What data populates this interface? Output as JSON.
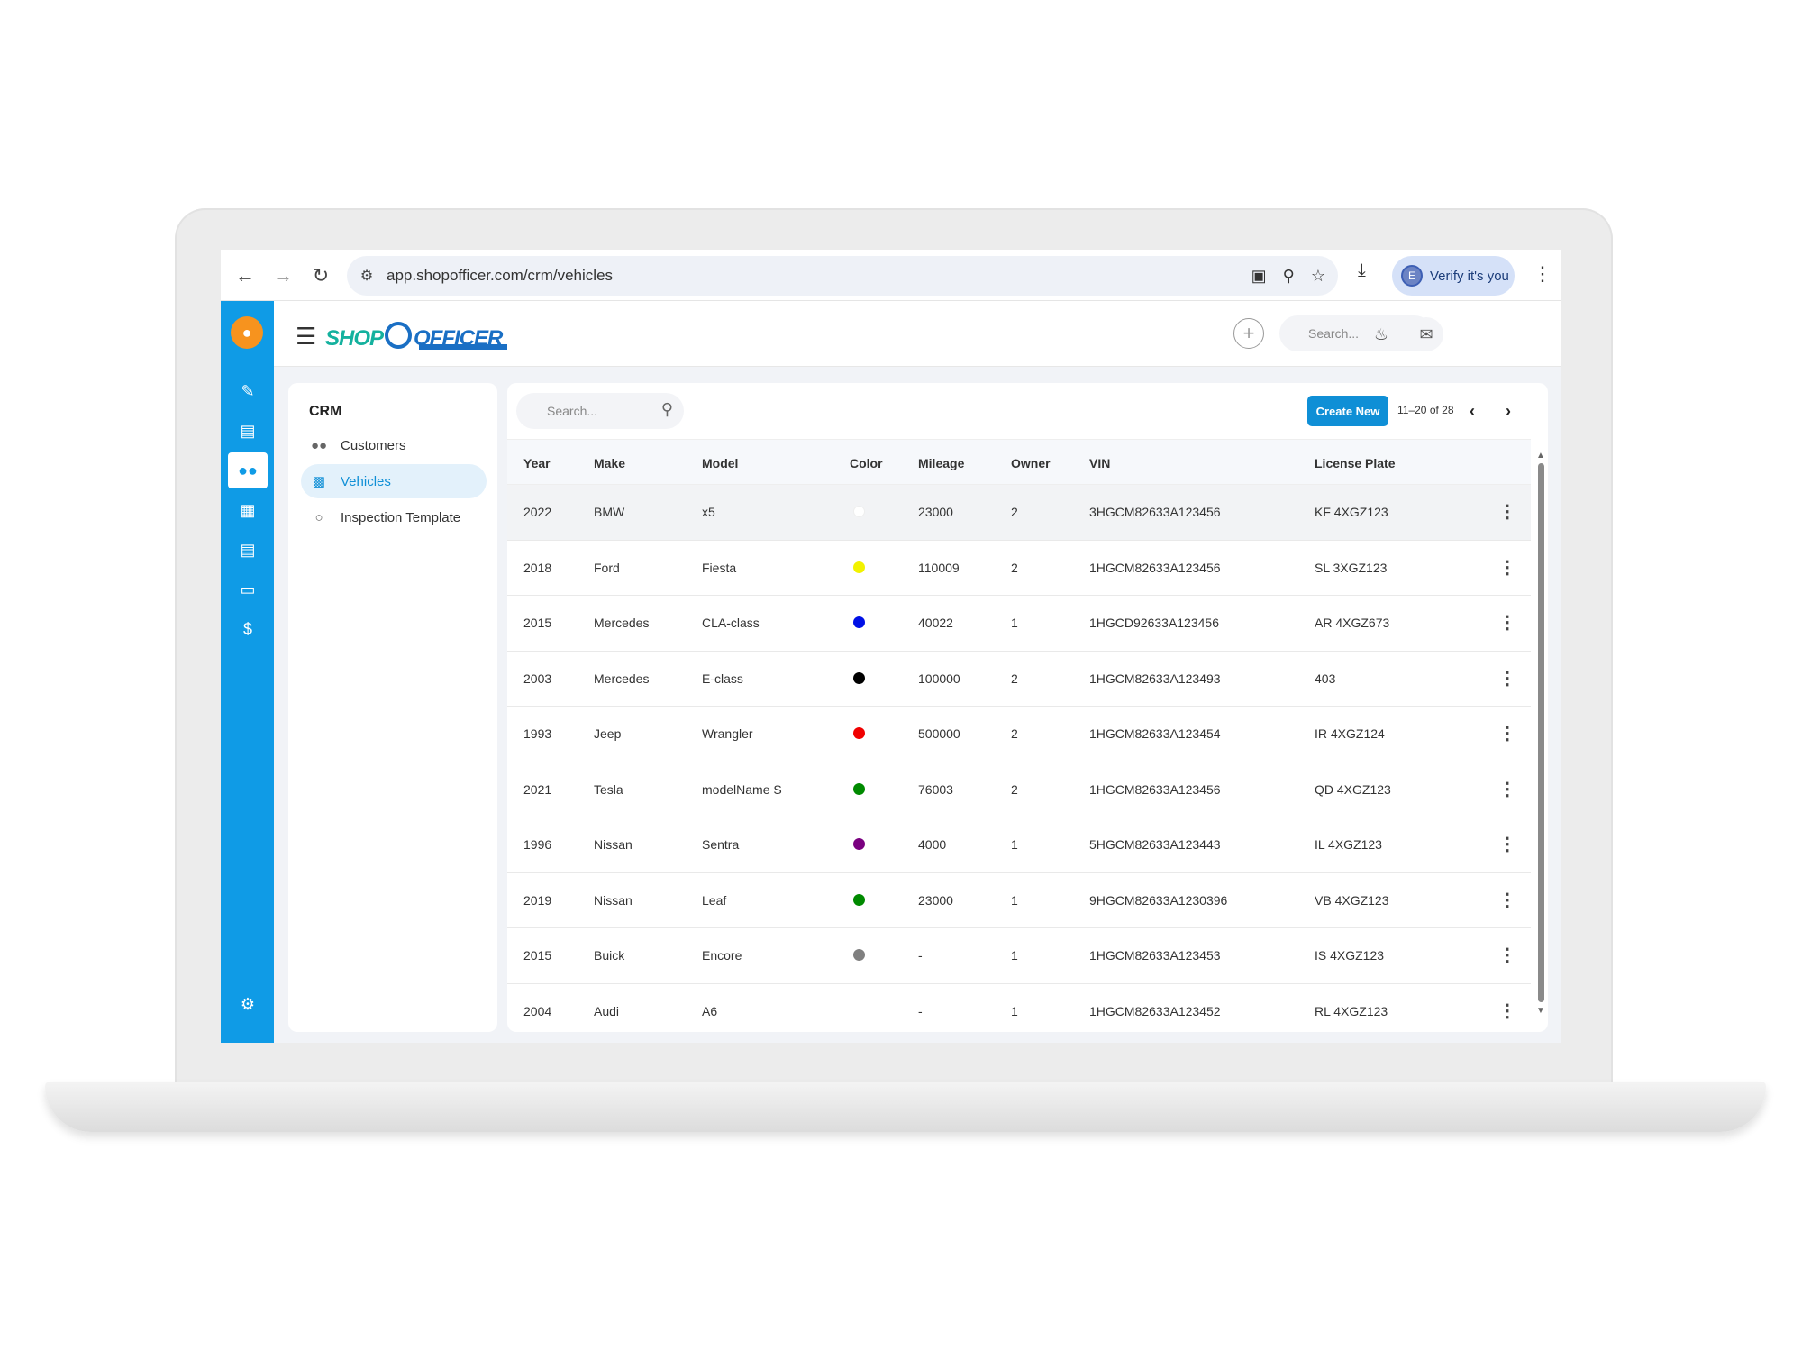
{
  "browser": {
    "url": "app.shopofficer.com/crm/vehicles",
    "verify_label": "Verify it's you",
    "verify_avatar": "E"
  },
  "app": {
    "logo_shop": "SHOP",
    "logo_officer": "OFFICER",
    "top_search_placeholder": "Search..."
  },
  "crm": {
    "title": "CRM",
    "items": [
      {
        "label": "Customers",
        "icon": "users-icon"
      },
      {
        "label": "Vehicles",
        "icon": "car-icon"
      },
      {
        "label": "Inspection Template",
        "icon": "person-icon"
      }
    ]
  },
  "main": {
    "search_placeholder": "Search...",
    "create_label": "Create New",
    "pager": "11–20 of 28",
    "columns": [
      "Year",
      "Make",
      "Model",
      "Color",
      "Mileage",
      "Owner",
      "VIN",
      "License Plate"
    ],
    "rows": [
      {
        "year": "2022",
        "make": "BMW",
        "model": "x5",
        "color": "#ffffff",
        "mileage": "23000",
        "owner": "2",
        "vin": "3HGCM82633A123456",
        "plate": "KF 4XGZ123"
      },
      {
        "year": "2018",
        "make": "Ford",
        "model": "Fiesta",
        "color": "#f2f200",
        "mileage": "110009",
        "owner": "2",
        "vin": "1HGCM82633A123456",
        "plate": "SL 3XGZ123"
      },
      {
        "year": "2015",
        "make": "Mercedes",
        "model": "CLA-class",
        "color": "#0010e6",
        "mileage": "40022",
        "owner": "1",
        "vin": "1HGCD92633A123456",
        "plate": "AR 4XGZ673"
      },
      {
        "year": "2003",
        "make": "Mercedes",
        "model": "E-class",
        "color": "#000000",
        "mileage": "100000",
        "owner": "2",
        "vin": "1HGCM82633A123493",
        "plate": "403"
      },
      {
        "year": "1993",
        "make": "Jeep",
        "model": "Wrangler",
        "color": "#f00000",
        "mileage": "500000",
        "owner": "2",
        "vin": "1HGCM82633A123454",
        "plate": "IR 4XGZ124"
      },
      {
        "year": "2021",
        "make": "Tesla",
        "model": "modelName S",
        "color": "#008a00",
        "mileage": "76003",
        "owner": "2",
        "vin": "1HGCM82633A123456",
        "plate": "QD 4XGZ123"
      },
      {
        "year": "1996",
        "make": "Nissan",
        "model": "Sentra",
        "color": "#7a0080",
        "mileage": "4000",
        "owner": "1",
        "vin": "5HGCM82633A123443",
        "plate": "IL 4XGZ123"
      },
      {
        "year": "2019",
        "make": "Nissan",
        "model": "Leaf",
        "color": "#008a00",
        "mileage": "23000",
        "owner": "1",
        "vin": "9HGCM82633A1230396",
        "plate": "VB 4XGZ123"
      },
      {
        "year": "2015",
        "make": "Buick",
        "model": "Encore",
        "color": "#808080",
        "mileage": "-",
        "owner": "1",
        "vin": "1HGCM82633A123453",
        "plate": "IS 4XGZ123"
      },
      {
        "year": "2004",
        "make": "Audi",
        "model": "A6",
        "color": "",
        "mileage": "-",
        "owner": "1",
        "vin": "1HGCM82633A123452",
        "plate": "RL 4XGZ123"
      }
    ]
  }
}
